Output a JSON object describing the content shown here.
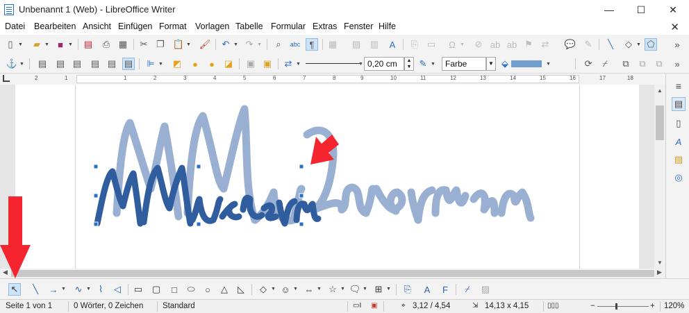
{
  "window": {
    "title": "Unbenannt 1 (Web) - LibreOffice Writer",
    "controls": {
      "minimize": "—",
      "maximize": "☐",
      "close": "✕"
    }
  },
  "menu": {
    "items": [
      "Datei",
      "Bearbeiten",
      "Ansicht",
      "Einfügen",
      "Format",
      "Vorlagen",
      "Tabelle",
      "Formular",
      "Extras",
      "Fenster",
      "Hilfe"
    ],
    "close_doc": "✕"
  },
  "toolbar_format": {
    "line_width": "0,20 cm",
    "area_style": "Farbe"
  },
  "ruler": {
    "numbers": [
      "2",
      "1",
      "1",
      "2",
      "3",
      "4",
      "5",
      "6",
      "7",
      "8",
      "9",
      "10",
      "11",
      "12",
      "13",
      "14",
      "15",
      "16",
      "17",
      "18"
    ]
  },
  "document": {
    "signature_light": "MMustermann",
    "signature_dark": "MMustermann",
    "colors": {
      "light_stroke": "#9ab0d2",
      "dark_stroke": "#2f5d9e",
      "annotation_red": "#f4252f"
    }
  },
  "status": {
    "page": "Seite 1 von 1",
    "words": "0 Wörter, 0 Zeichen",
    "style": "Standard",
    "position": "3,12 / 4,54",
    "size": "14,13 x 4,15",
    "zoom": "120%"
  },
  "colors": {
    "accent": "#2a6fc9",
    "selected_tool_bg": "#cde3f7"
  }
}
